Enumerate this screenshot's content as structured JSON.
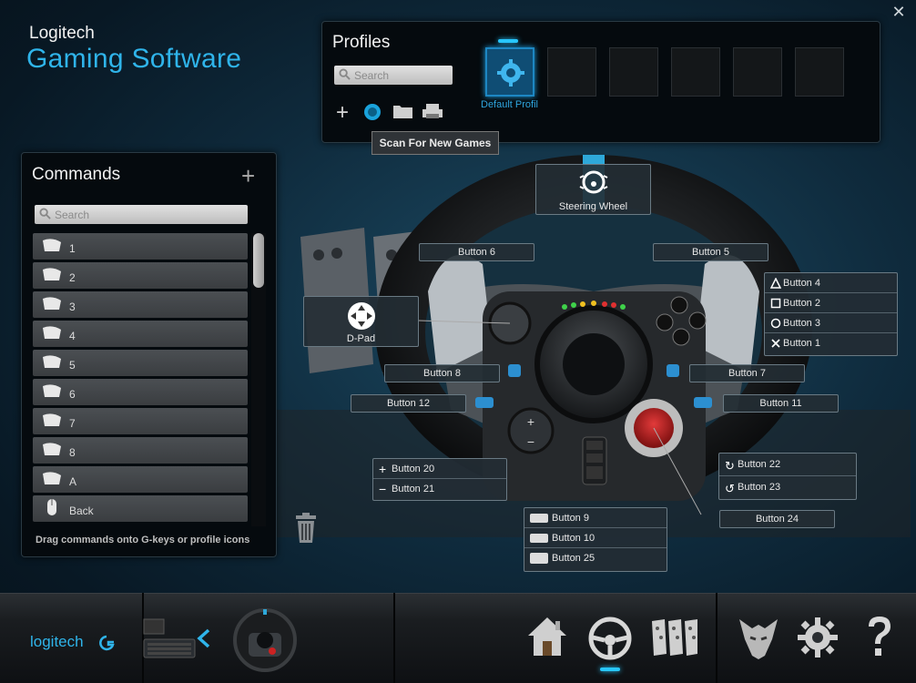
{
  "app": {
    "brand_top": "Logitech",
    "brand_main": "Gaming Software",
    "close": "✕"
  },
  "profiles": {
    "title": "Profiles",
    "search_placeholder": "Search",
    "tooltip": "Scan For New Games",
    "active_slot_label": "Default Profil",
    "icons": [
      "add-icon",
      "scan-icon",
      "folder-icon",
      "printer-icon"
    ]
  },
  "commands": {
    "title": "Commands",
    "add": "+",
    "search_placeholder": "Search",
    "items": [
      "1",
      "2",
      "3",
      "4",
      "5",
      "6",
      "7",
      "8",
      "A",
      "Back"
    ],
    "hint": "Drag commands onto G-keys or profile icons"
  },
  "device": {
    "steering_wheel": "Steering Wheel",
    "dpad": "D-Pad",
    "button5": "Button 5",
    "button6": "Button 6",
    "button7": "Button 7",
    "button8": "Button 8",
    "button11": "Button 11",
    "button12": "Button 12",
    "button24": "Button 24",
    "face_buttons": [
      "Button 4",
      "Button 2",
      "Button 3",
      "Button 1"
    ],
    "plus_minus": [
      "Button 20",
      "Button 21"
    ],
    "rotary": [
      "Button 22",
      "Button 23"
    ],
    "center": [
      "Button 9",
      "Button 10",
      "Button 25"
    ]
  },
  "colors": {
    "accent": "#2fb4ea",
    "panel": "#050a0e"
  }
}
